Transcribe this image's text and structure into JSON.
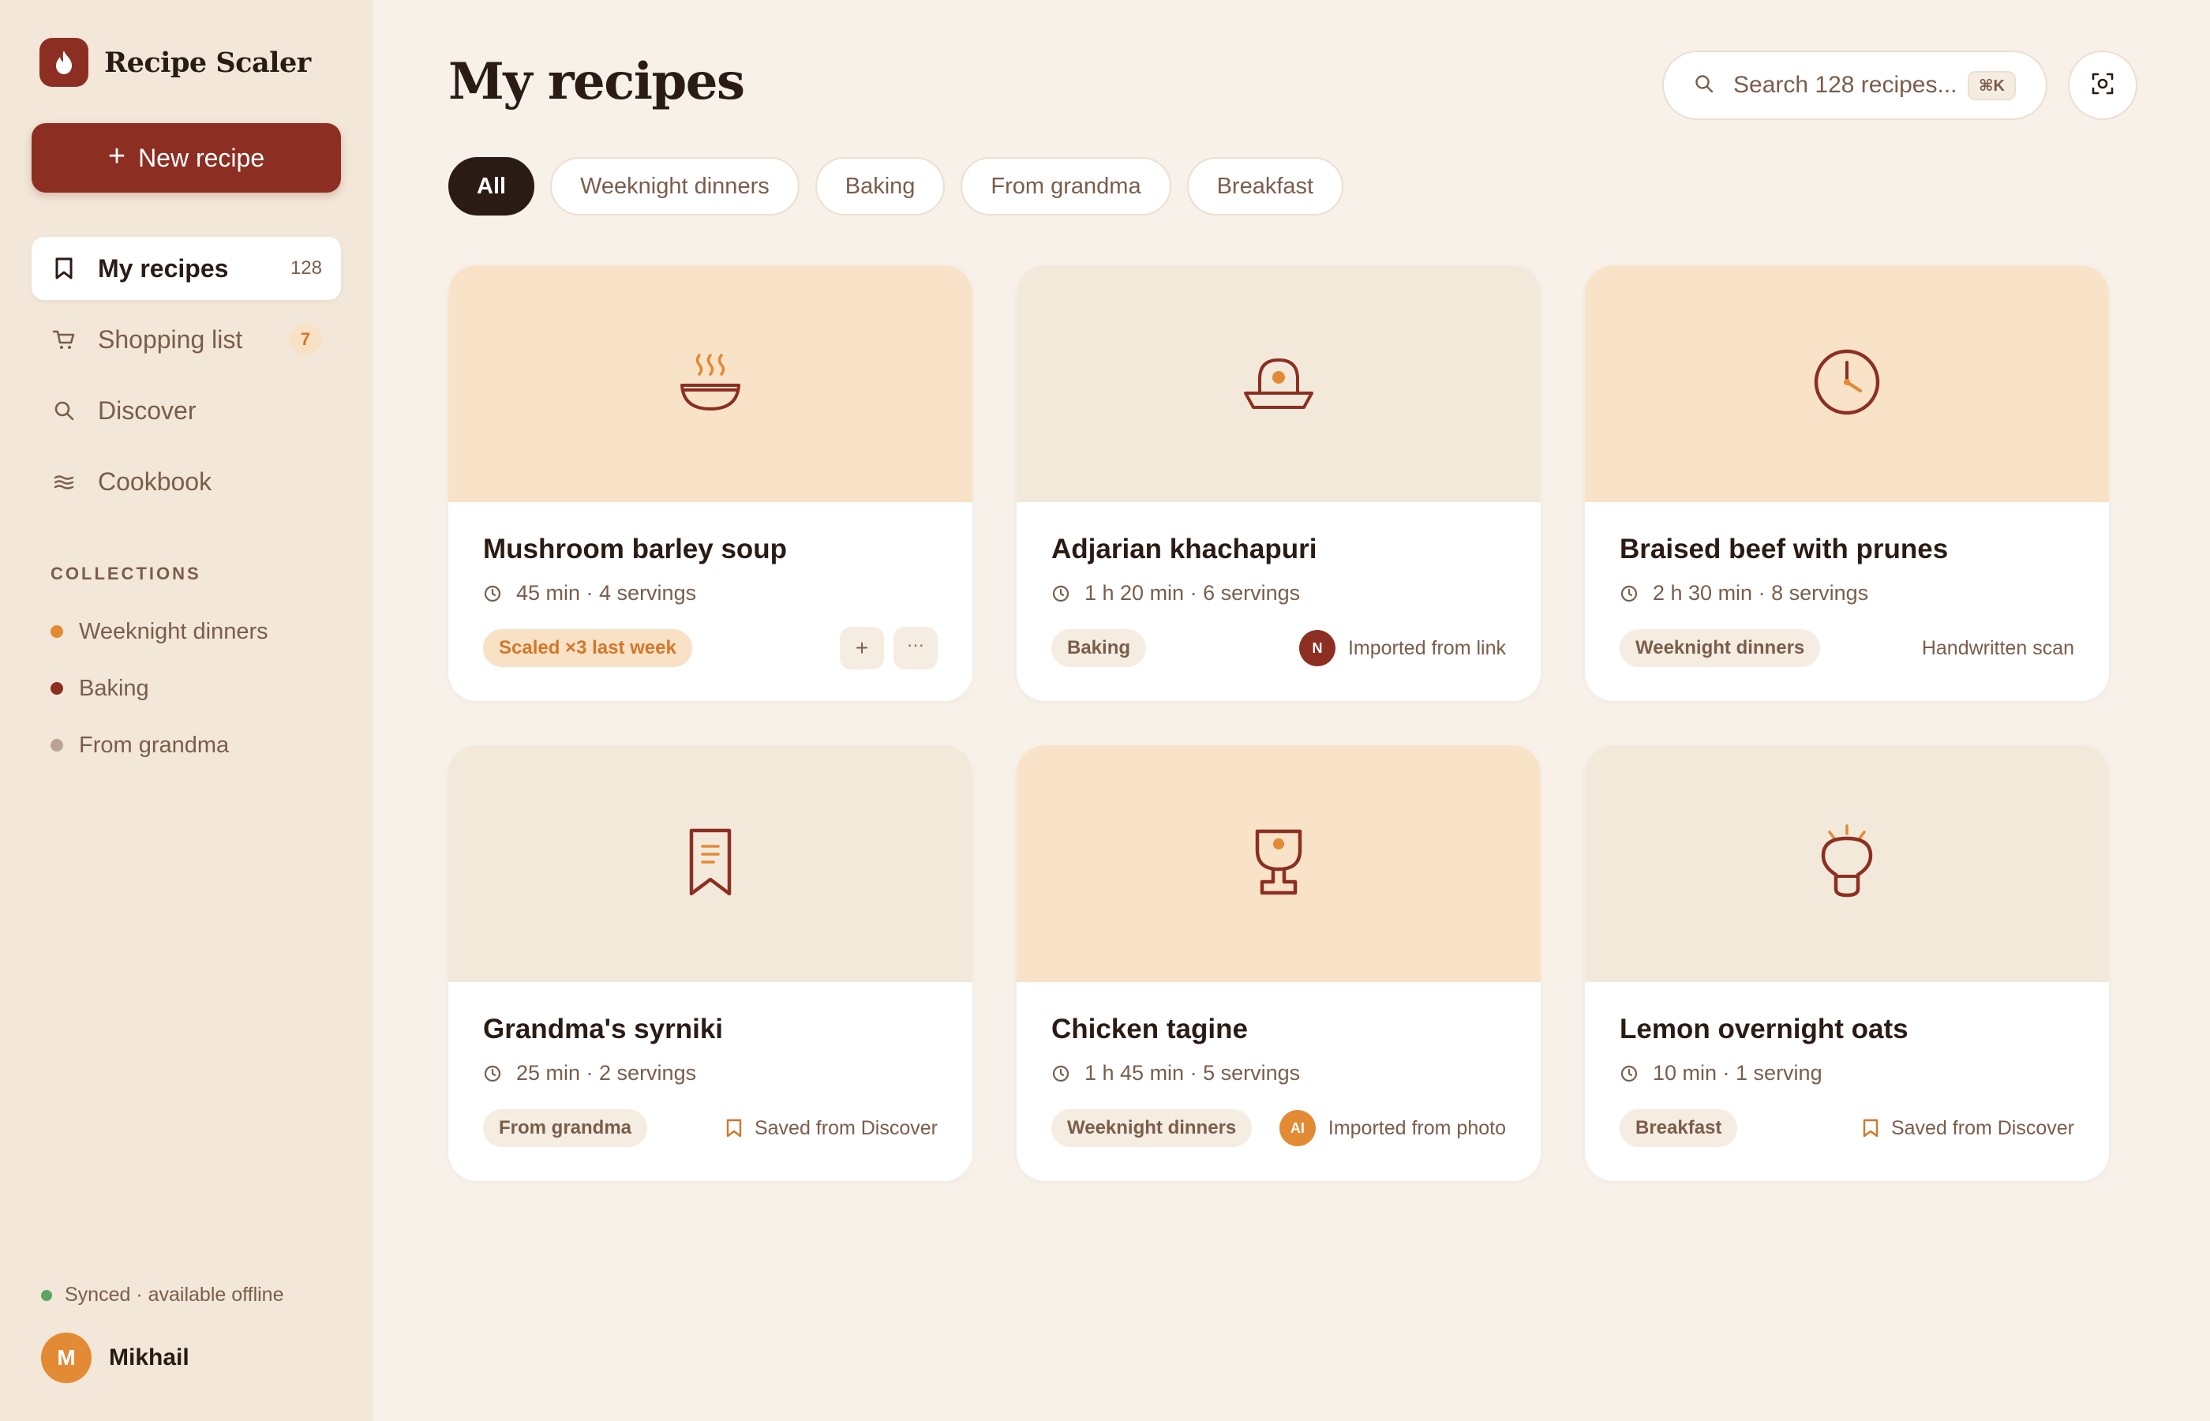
{
  "app": {
    "name": "Recipe Scaler"
  },
  "sidebar": {
    "new_recipe_label": "New recipe",
    "nav": [
      {
        "label": "My recipes",
        "count": "128",
        "icon": "bookmark-icon"
      },
      {
        "label": "Shopping list",
        "badge": "7",
        "icon": "cart-icon"
      },
      {
        "label": "Discover",
        "icon": "search-icon"
      },
      {
        "label": "Cookbook",
        "icon": "cookbook-icon"
      }
    ],
    "collections_title": "COLLECTIONS",
    "collections": [
      {
        "label": "Weeknight dinners",
        "color": "#e38a34"
      },
      {
        "label": "Baking",
        "color": "#8c2f22"
      },
      {
        "label": "From grandma",
        "color": "#b9a494"
      }
    ],
    "sync_status": "Synced · available offline",
    "user": {
      "initial": "M",
      "name": "Mikhail"
    }
  },
  "header": {
    "title": "My recipes",
    "search_placeholder": "Search 128 recipes...",
    "search_shortcut": "⌘K"
  },
  "filters": [
    "All",
    "Weeknight dinners",
    "Baking",
    "From grandma",
    "Breakfast"
  ],
  "recipes": [
    {
      "title": "Mushroom barley soup",
      "meta": "45 min · 4 servings",
      "tag": "Scaled ×3 last week",
      "icon": "soup-bowl-icon"
    },
    {
      "title": "Adjarian khachapuri",
      "meta": "1 h 20 min · 6 servings",
      "tag": "Baking",
      "source_initial": "N",
      "source": "Imported from link",
      "icon": "khachapuri-icon"
    },
    {
      "title": "Braised beef with prunes",
      "meta": "2 h 30 min · 8 servings",
      "tag": "Weeknight dinners",
      "source": "Handwritten scan",
      "icon": "clock-icon"
    },
    {
      "title": "Grandma's syrniki",
      "meta": "25 min · 2 servings",
      "tag": "From grandma",
      "source": "Saved from Discover",
      "icon": "recipe-bookmark-icon"
    },
    {
      "title": "Chicken tagine",
      "meta": "1 h 45 min · 5 servings",
      "tag": "Weeknight dinners",
      "source_initial": "AI",
      "source": "Imported from photo",
      "icon": "goblet-icon"
    },
    {
      "title": "Lemon overnight oats",
      "meta": "10 min · 1 serving",
      "tag": "Breakfast",
      "source": "Saved from Discover",
      "icon": "oats-jar-icon"
    }
  ],
  "colors": {
    "brand": "#8c2f22",
    "accent": "#e38a34",
    "hero_peach": "#f8e3c8",
    "hero_cream": "#f2e9db"
  }
}
